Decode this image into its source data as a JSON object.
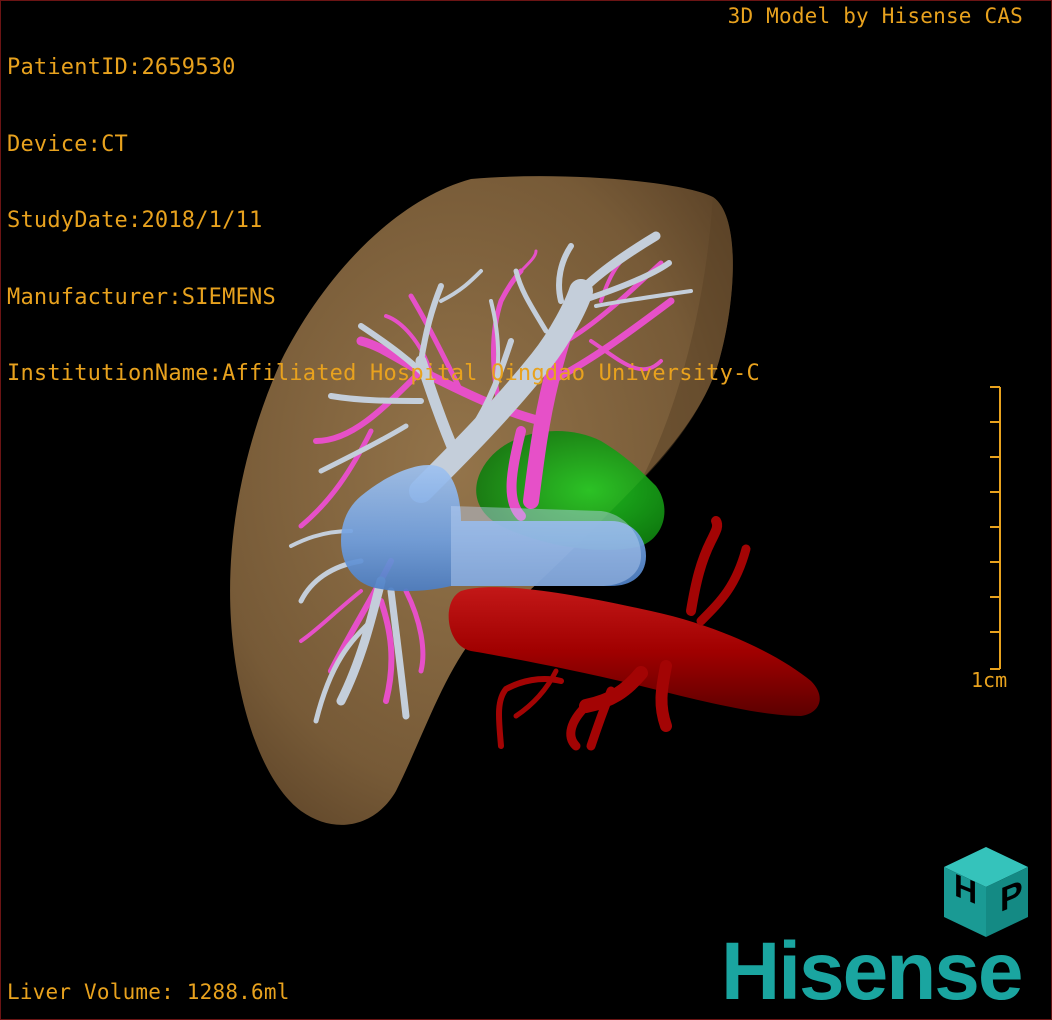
{
  "viewer": {
    "info_lines": [
      "PatientID:2659530",
      "Device:CT",
      "StudyDate:2018/1/11",
      "Manufacturer:SIEMENS",
      "InstitutionName:Affiliated Hospital Qingdao University-C"
    ],
    "credit": "3D Model by Hisense CAS",
    "scale_label": "1cm",
    "liver_volume": "Liver Volume: 1288.6ml"
  },
  "logo": {
    "brand": "Hisense",
    "cube_letters": "HP"
  },
  "colors": {
    "overlay_text": "#e8a21e",
    "liver": "#8a6a42",
    "hepatic_vein": "#b9c4d2",
    "portal_vein": "#e650c8",
    "vena_cava": "#6f9fe0",
    "gallbladder": "#18b418",
    "aorta": "#a00000",
    "brand": "#1aa5a0"
  },
  "model": {
    "structures": [
      "liver",
      "hepatic-veins",
      "portal-veins",
      "vena-cava",
      "gallbladder",
      "aorta"
    ]
  }
}
